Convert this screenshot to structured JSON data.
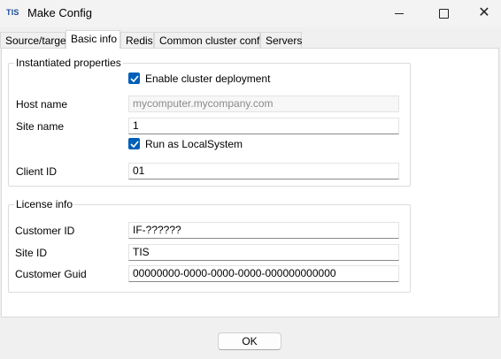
{
  "window": {
    "logo_text": "TIS",
    "title": "Make Config",
    "controls": {
      "minimize": "minimize",
      "maximize": "maximize",
      "close": "✕"
    }
  },
  "tabs": [
    {
      "label": "Source/target",
      "active": false
    },
    {
      "label": "Basic info",
      "active": true
    },
    {
      "label": "Redis",
      "active": false
    },
    {
      "label": "Common cluster config",
      "active": false
    },
    {
      "label": "Servers",
      "active": false
    }
  ],
  "instantiated": {
    "title": "Instantiated properties",
    "enable_cluster": {
      "label": "Enable cluster deployment",
      "checked": true
    },
    "host_name": {
      "label": "Host name",
      "value": "mycomputer.mycompany.com",
      "enabled": false
    },
    "site_name": {
      "label": "Site name",
      "value": "1"
    },
    "run_as_local": {
      "label": "Run as LocalSystem",
      "checked": true
    },
    "client_id": {
      "label": "Client ID",
      "value": "01"
    }
  },
  "license": {
    "title": "License info",
    "customer_id": {
      "label": "Customer ID",
      "value": "IF-??????"
    },
    "site_id": {
      "label": "Site ID",
      "value": "TIS"
    },
    "customer_guid": {
      "label": "Customer Guid",
      "value": "00000000-0000-0000-0000-000000000000"
    }
  },
  "footer": {
    "ok_label": "OK"
  },
  "colors": {
    "accent": "#005fb8",
    "logo": "#1f4e9a",
    "background": "#f0f0f0"
  }
}
